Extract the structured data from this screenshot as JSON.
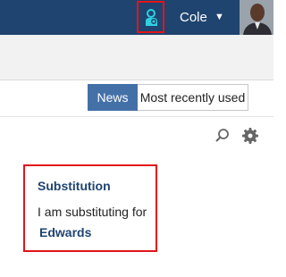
{
  "header": {
    "substitution_icon": "substitution-person-icon",
    "user_name": "Cole",
    "user_menu_icon": "caret-down-icon",
    "avatar_icon": "user-avatar"
  },
  "tabs": [
    {
      "label": "News",
      "active": true
    },
    {
      "label": "Most recently used",
      "active": false
    }
  ],
  "toolbar": {
    "search_icon": "search-icon",
    "settings_icon": "gear-icon"
  },
  "widget": {
    "title": "Substitution",
    "text": "I am substituting for",
    "link": "Edwards"
  },
  "colors": {
    "header_bg": "#1f4470",
    "accent_tab": "#4470a8",
    "highlight": "#e3141b",
    "icon_teal": "#2fd0e0"
  }
}
